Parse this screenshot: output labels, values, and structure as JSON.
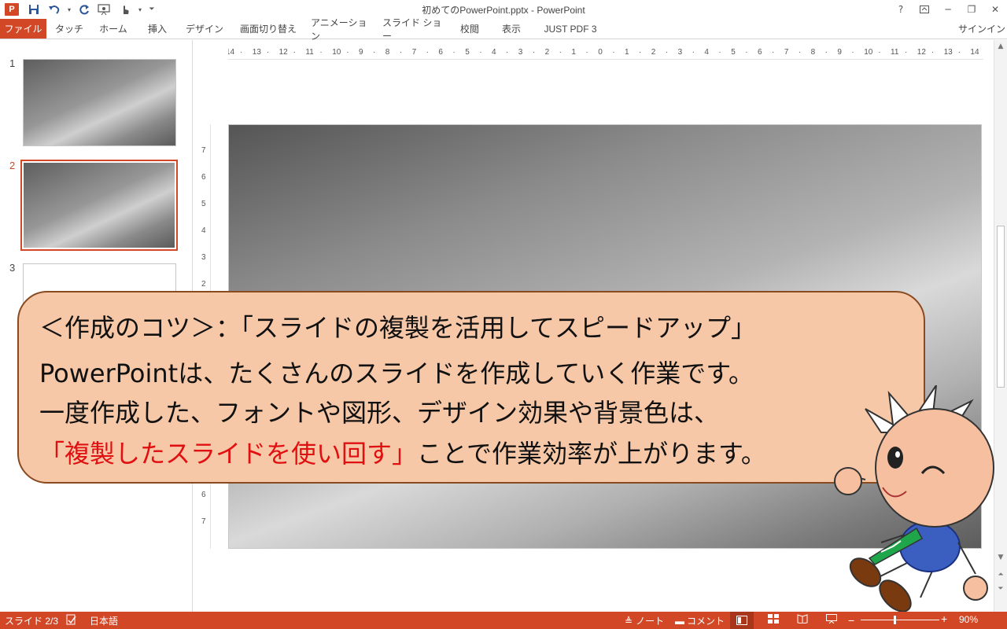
{
  "window": {
    "title": "初めてのPowerPoint.pptx - PowerPoint",
    "help": "?",
    "min": "─",
    "max": "❐",
    "close": "✕"
  },
  "ribbon": {
    "tabs": [
      "ファイル",
      "タッチ",
      "ホーム",
      "挿入",
      "デザイン",
      "画面切り替え",
      "アニメーション",
      "スライド ショー",
      "校閲",
      "表示",
      "JUST PDF 3"
    ],
    "signin": "サインイン"
  },
  "slides_pane": {
    "numbers": [
      "1",
      "2",
      "3"
    ],
    "selected": 2
  },
  "ruler": {
    "horizontal": [
      "14",
      "13",
      "12",
      "11",
      "10",
      "9",
      "8",
      "7",
      "6",
      "5",
      "4",
      "3",
      "2",
      "1",
      "0",
      "1",
      "2",
      "3",
      "4",
      "5",
      "6",
      "7",
      "8",
      "9",
      "10",
      "11",
      "12",
      "13",
      "14"
    ],
    "vertical_top": [
      "7",
      "6",
      "5",
      "4",
      "3",
      "2"
    ],
    "vertical_bottom": [
      "6",
      "7"
    ]
  },
  "callout": {
    "line1": "＜作成のコツ＞：「スライドの複製を活用してスピードアップ」",
    "line2": "PowerPointは、たくさんのスライドを作成していく作業です。",
    "line3": "一度作成した、フォントや図形、デザイン効果や背景色は、",
    "line4_red": "「複製したスライドを使い回す」",
    "line4_rest": "ことで作業効率が上がります。",
    "colors": {
      "fill": "#f6c8a8",
      "border": "#8a4a20",
      "accent_text": "#e01010"
    }
  },
  "status": {
    "slide_info": "スライド 2/3",
    "language": "日本語",
    "notes": "ノート",
    "comments": "コメント",
    "zoom_minus": "−",
    "zoom_plus": "+",
    "zoom": "90%",
    "zoom_level": 0.42
  },
  "theme": {
    "accent": "#d24726"
  }
}
